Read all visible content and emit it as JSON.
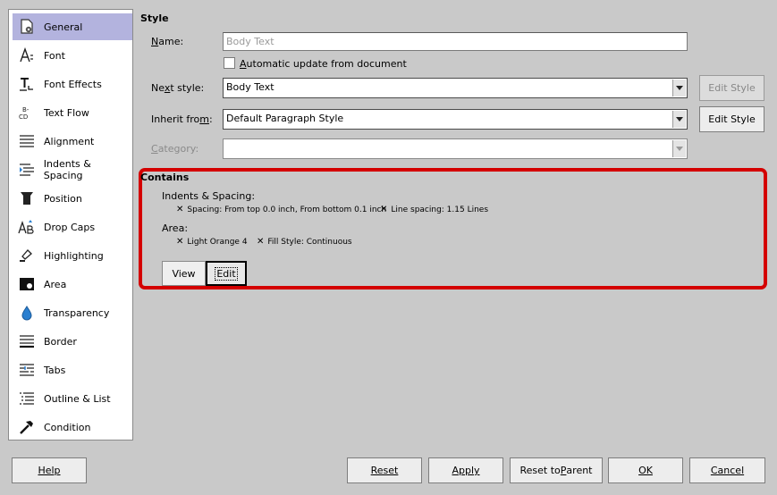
{
  "sidebar": {
    "items": [
      {
        "label": "General",
        "icon": "general-page-icon"
      },
      {
        "label": "Font",
        "icon": "font-icon"
      },
      {
        "label": "Font Effects",
        "icon": "font-effects-icon"
      },
      {
        "label": "Text Flow",
        "icon": "text-flow-icon"
      },
      {
        "label": "Alignment",
        "icon": "alignment-icon"
      },
      {
        "label": "Indents & Spacing",
        "icon": "indents-spacing-icon"
      },
      {
        "label": "Position",
        "icon": "position-icon"
      },
      {
        "label": "Drop Caps",
        "icon": "drop-caps-icon"
      },
      {
        "label": "Highlighting",
        "icon": "highlighting-icon"
      },
      {
        "label": "Area",
        "icon": "area-icon"
      },
      {
        "label": "Transparency",
        "icon": "transparency-icon"
      },
      {
        "label": "Border",
        "icon": "border-icon"
      },
      {
        "label": "Tabs",
        "icon": "tabs-icon"
      },
      {
        "label": "Outline & List",
        "icon": "outline-list-icon"
      },
      {
        "label": "Condition",
        "icon": "condition-icon"
      }
    ],
    "selected": "General"
  },
  "style": {
    "title": "Style",
    "name_label_u": "N",
    "name_label_rest": "ame:",
    "name_placeholder": "Body Text",
    "auto_update_label_u": "A",
    "auto_update_label_rest": "utomatic update from document",
    "next_style_label_a": "Ne",
    "next_style_label_u": "x",
    "next_style_label_b": "t style:",
    "next_style_value": "Body Text",
    "inherit_label_a": "Inherit fro",
    "inherit_label_u": "m",
    "inherit_label_b": ":",
    "inherit_value": "Default Paragraph Style",
    "category_label_u": "C",
    "category_label_rest": "ategory:",
    "category_value": "",
    "edit_style_label": "Edit Style"
  },
  "contains": {
    "title": "Contains",
    "groups": [
      {
        "title": "Indents & Spacing:",
        "items": [
          "Spacing: From top 0.0 inch, From bottom 0.1 inch",
          "Line spacing: 1.15 Lines"
        ]
      },
      {
        "title": "Area:",
        "items": [
          "Light Orange 4",
          "Fill Style: Continuous"
        ]
      }
    ],
    "view_label": "View",
    "edit_label": "Edit"
  },
  "footer": {
    "help": "Help",
    "reset": "Reset",
    "apply": "Apply",
    "reset_parent_a": "Reset to ",
    "reset_parent_u": "P",
    "reset_parent_b": "arent",
    "ok": "OK",
    "cancel": "Cancel"
  },
  "colors": {
    "selection": "#b3b3de",
    "highlight_border": "#d40000"
  }
}
